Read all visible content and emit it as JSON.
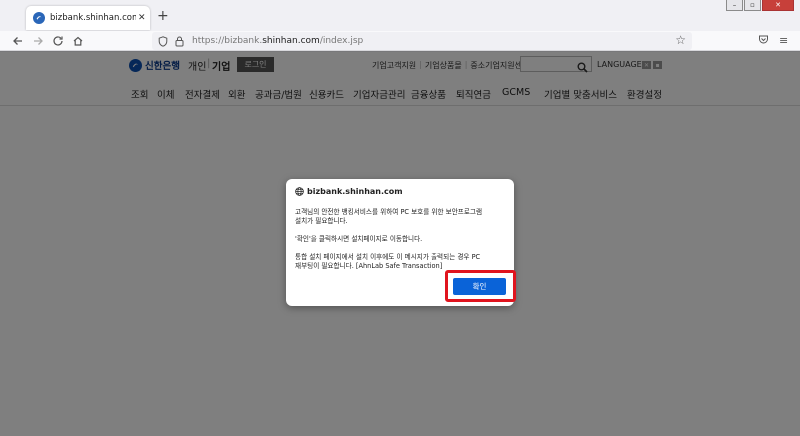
{
  "browser": {
    "tab_title": "bizbank.shinhan.com/index.jsp",
    "tab_close": "✕",
    "new_tab": "+",
    "url_prefix": "https://bizbank.",
    "url_domain": "shinhan.com",
    "url_path": "/index.jsp",
    "icons": {
      "back": "back-arrow-icon",
      "forward": "forward-arrow-icon",
      "reload": "reload-icon",
      "home": "home-icon",
      "bookmark": "star-icon",
      "pocket": "pocket-icon",
      "menu": "hamburger-menu-icon"
    }
  },
  "site": {
    "logo_name": "신한은행",
    "segment_personal": "개인",
    "segment_sep": "|",
    "segment_corporate": "기업",
    "login_label": "로그인",
    "top_links": [
      "기업고객지원",
      "기업상품몰",
      "중소기업지원센터"
    ],
    "language_label": "LANGUAGE",
    "lang_prev": "✕",
    "lang_next": "▪",
    "gnb": [
      "조회",
      "이체",
      "전자결제",
      "외환",
      "공과금/법원",
      "신용카드",
      "기업자금관리",
      "금융상품",
      "퇴직연금",
      "GCMS",
      "기업별 맞춤서비스",
      "환경설정"
    ]
  },
  "dialog": {
    "origin": "bizbank.shinhan.com",
    "message": "고객님의 안전한 뱅킹서비스를 위하여 PC 보호를 위한 보안프로그램\n설치가 필요합니다.\n\n'확인'을 클릭하시면 설치페이지로 이동합니다.\n\n통합 설치 페이지에서 설치 이후에도 이 메시지가 출력되는 경우 PC\n재부팅이 필요합니다. [AhnLab Safe Transaction]",
    "ok_label": "확인"
  },
  "colors": {
    "ok_button": "#0a63d8",
    "highlight": "#e0141e",
    "overlay": "rgba(0,0,0,0.5)"
  }
}
